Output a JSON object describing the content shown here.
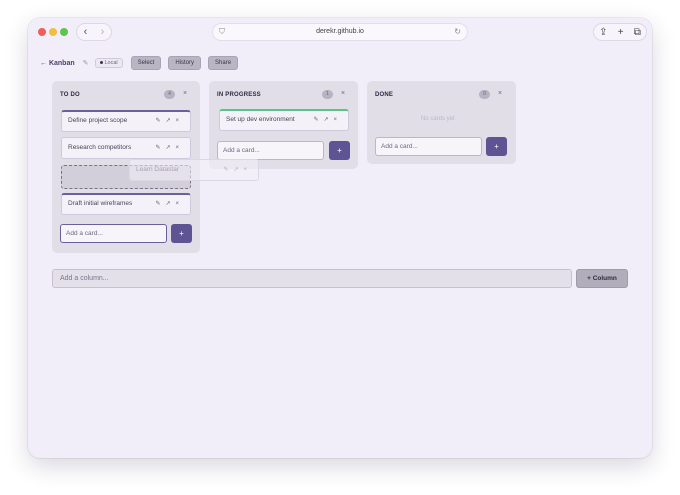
{
  "browser": {
    "url": "derekr.github.io",
    "back_icon": "‹",
    "forward_icon": "›",
    "shield_icon": "⛉",
    "reload_icon": "↻",
    "share_icon": "⇪",
    "newtab_icon": "+",
    "tabs_icon": "⧉"
  },
  "toolbar": {
    "back_label": "← Kanban",
    "edit_icon": "✎",
    "local_label": "Local",
    "select_label": "Select",
    "history_label": "History",
    "share_label": "Share"
  },
  "columns": [
    {
      "title": "TO DO",
      "count": "4",
      "close_icon": "×",
      "cards": [
        {
          "text": "Define project scope",
          "actions": "✎↗×"
        },
        {
          "text": "Research competitors",
          "actions": "✎↗×"
        },
        {
          "text": "Draft initial wireframes",
          "actions": "✎↗×"
        }
      ],
      "input_placeholder": "Add a card...",
      "add_label": "+"
    },
    {
      "title": "IN PROGRESS",
      "count": "1",
      "close_icon": "×",
      "cards": [
        {
          "text": "Set up dev environment",
          "actions": "✎↗×"
        }
      ],
      "input_placeholder": "Add a card...",
      "add_label": "+"
    },
    {
      "title": "DONE",
      "count": "0",
      "close_icon": "×",
      "empty_text": "No cards yet",
      "input_placeholder": "Add a card...",
      "add_label": "+"
    }
  ],
  "dragging_card": {
    "text": "Learn Datastar",
    "actions": "✎↗×"
  },
  "add_column": {
    "placeholder": "Add a column...",
    "button_label": "+ Column"
  },
  "colors": {
    "accent": "#5e5494",
    "in_progress_accent": "#5cc28a",
    "window_bg": "#f2eef9",
    "column_bg": "#e2dee8"
  }
}
